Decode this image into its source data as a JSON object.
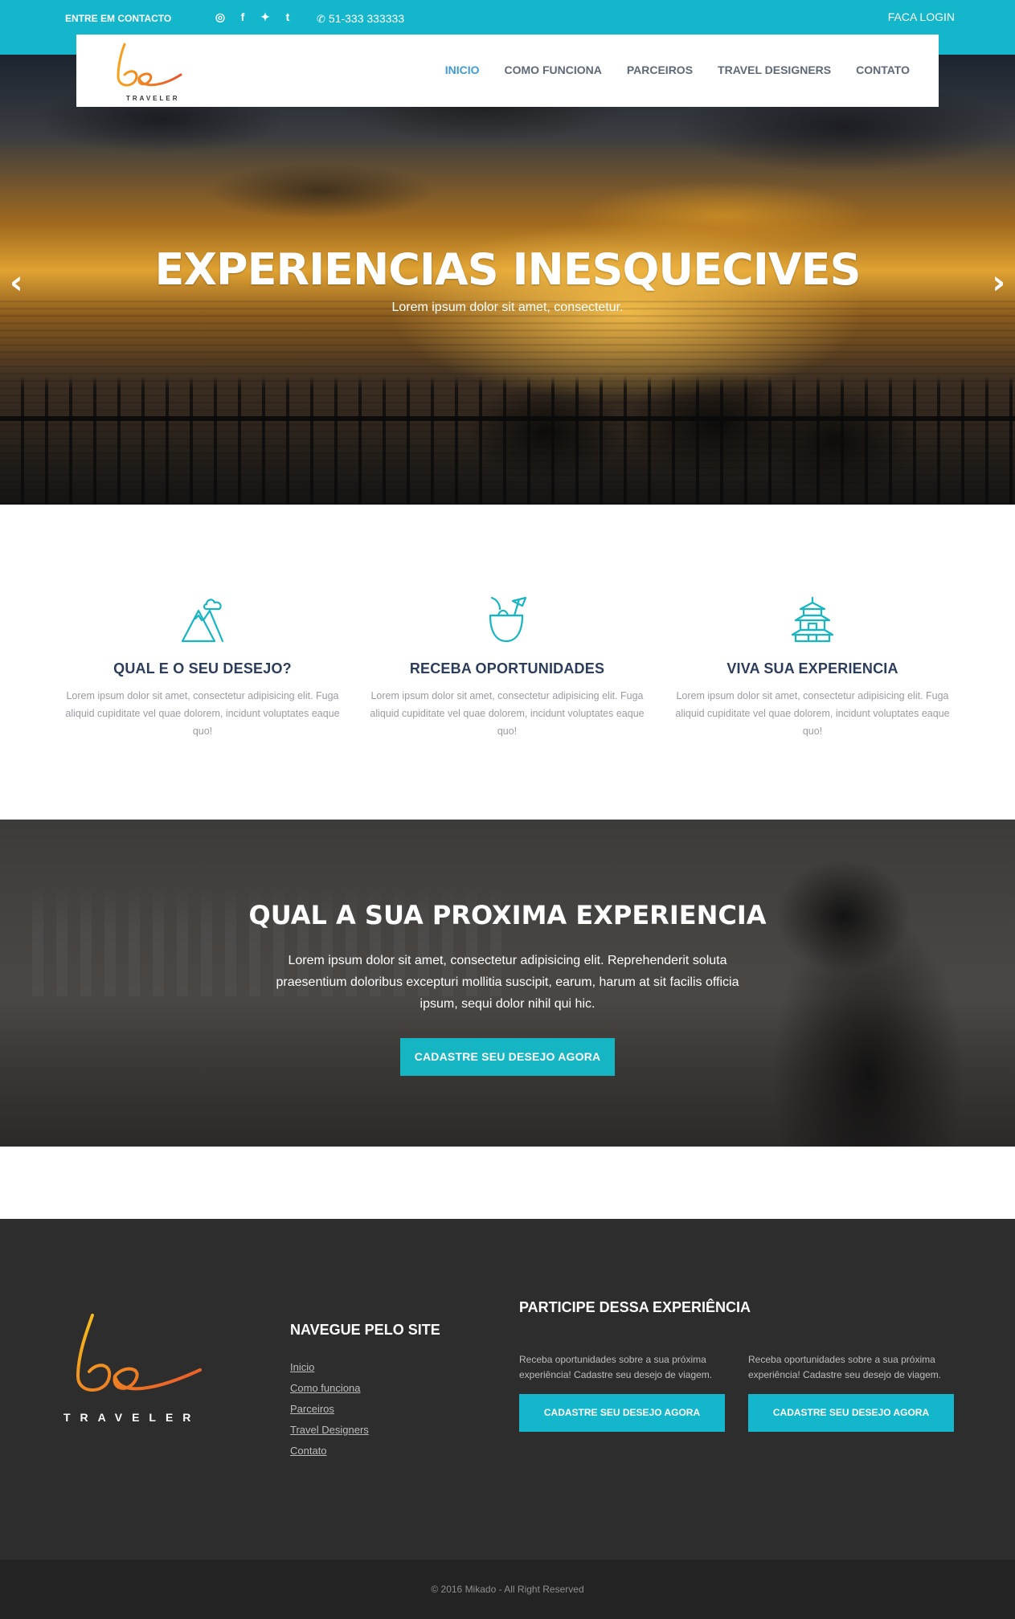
{
  "topbar": {
    "contact": "ENTRE EM CONTACTO",
    "social": [
      {
        "icon": "instagram-icon",
        "glyph": "◎"
      },
      {
        "icon": "facebook-icon",
        "glyph": "f"
      },
      {
        "icon": "twitter-icon",
        "glyph": "✦"
      },
      {
        "icon": "tumblr-icon",
        "glyph": "t"
      }
    ],
    "phone": "51-333 333333",
    "login": "FACA LOGIN",
    "color": "#14b6cb"
  },
  "brand": {
    "logo_text": "TRAVELER",
    "logo_mark": "be"
  },
  "nav": {
    "items": [
      {
        "label": "INICIO",
        "active": true
      },
      {
        "label": "COMO FUNCIONA"
      },
      {
        "label": "PARCEIROS"
      },
      {
        "label": "TRAVEL DESIGNERS"
      },
      {
        "label": "CONTATO"
      }
    ]
  },
  "hero": {
    "title": "EXPERIENCIAS INESQUECIVES",
    "subtitle": "Lorem ipsum dolor sit amet, consectetur."
  },
  "features": [
    {
      "icon": "mountain-icon",
      "title": "QUAL E O SEU DESEJO?",
      "text": "Lorem ipsum dolor sit amet, consectetur adipisicing elit. Fuga aliquid cupiditate vel quae dolorem, incidunt voluptates eaque quo!"
    },
    {
      "icon": "coconut-drink-icon",
      "title": "RECEBA OPORTUNIDADES",
      "text": "Lorem ipsum dolor sit amet, consectetur adipisicing elit. Fuga aliquid cupiditate vel quae dolorem, incidunt voluptates eaque quo!"
    },
    {
      "icon": "pagoda-icon",
      "title": "VIVA SUA EXPERIENCIA",
      "text": "Lorem ipsum dolor sit amet, consectetur adipisicing elit. Fuga aliquid cupiditate vel quae dolorem, incidunt voluptates eaque quo!"
    }
  ],
  "cta": {
    "title": "QUAL A SUA PROXIMA EXPERIENCIA",
    "text": "Lorem ipsum dolor sit amet, consectetur adipisicing elit. Reprehenderit soluta praesentium doloribus excepturi mollitia suscipit, earum, harum at sit facilis officia ipsum, sequi dolor nihil qui hic.",
    "button": "CADASTRE SEU DESEJO AGORA"
  },
  "footer": {
    "nav_title": "NAVEGUE PELO SITE",
    "links": [
      "Inicio",
      "Como funciona",
      "Parceiros",
      "Travel Designers",
      "Contato"
    ],
    "participate_title": "PARTICIPE DESSA EXPERIÊNCIA",
    "columns": [
      {
        "text": "Receba oportunidades sobre a sua próxima experiência! Cadastre seu desejo de viagem.",
        "button": "CADASTRE SEU DESEJO AGORA"
      },
      {
        "text": "Receba oportunidades sobre a sua próxima experiência! Cadastre seu desejo de viagem.",
        "button": "CADASTRE SEU DESEJO AGORA"
      }
    ],
    "copyright": "© 2016 Mikado - All Right Reserved"
  }
}
